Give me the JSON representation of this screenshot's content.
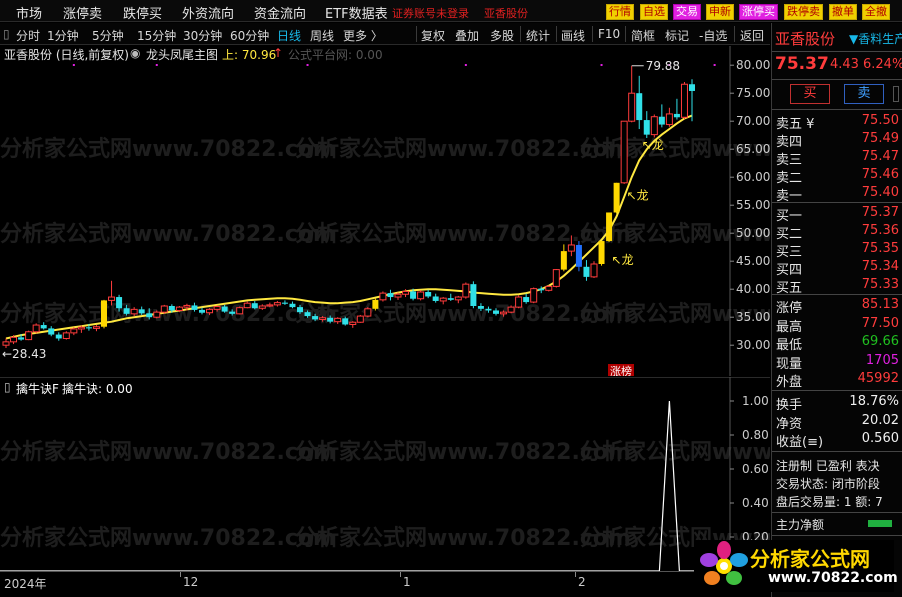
{
  "menu": {
    "items": [
      "市场",
      "涨停卖",
      "跌停买",
      "外资流向",
      "资金流向",
      "ETF数据表"
    ],
    "warning": "证券账号未登录",
    "stock": "亚香股份",
    "buttons": [
      "行情",
      "自选",
      "交易",
      "申新",
      "涨停买",
      "跌停卖",
      "撤单",
      "全撤"
    ]
  },
  "toolbar": {
    "periods": [
      "分时",
      "1分钟",
      "5分钟",
      "15分钟",
      "30分钟",
      "60分钟",
      "日线",
      "周线",
      "更多 〉"
    ],
    "active": "日线",
    "actions": [
      "复权",
      "叠加",
      "多股",
      "统计",
      "画线",
      "F10",
      "简框",
      "标记",
      "-自选",
      "返回"
    ]
  },
  "chart_info": {
    "title": "亚香股份 (日线,前复权)",
    "indicator": "龙头凤尾主图",
    "upper_label": "上: 70.96",
    "watermark_text": "公式平台网: 0.00",
    "high_label": "79.88",
    "low_label": "28.43",
    "dragon_label": "龙",
    "limit_label": "涨榜",
    "watermark": "分析家公式网www.70822.com"
  },
  "sub_chart": {
    "name": "擒牛诀F",
    "value_label": "擒牛诀: 0.00",
    "yticks": [
      "1.00",
      "0.80",
      "0.60",
      "0.40",
      "0.20"
    ]
  },
  "axis": {
    "price_ticks": [
      "80.00",
      "75.00",
      "70.00",
      "65.00",
      "60.00",
      "55.00",
      "50.00",
      "45.00",
      "40.00",
      "35.00",
      "30.00"
    ],
    "x_labels": [
      "2024年",
      "12",
      "1",
      "2"
    ]
  },
  "chart_data": {
    "type": "candlestick",
    "ylim": [
      27,
      82
    ],
    "candles": [
      [
        30.0,
        31.2,
        29.5,
        30.6
      ],
      [
        30.6,
        31.8,
        30.2,
        31.4
      ],
      [
        31.4,
        32.0,
        30.8,
        31.0
      ],
      [
        31.0,
        32.6,
        30.9,
        32.4
      ],
      [
        32.4,
        33.9,
        32.1,
        33.6
      ],
      [
        33.6,
        34.1,
        32.8,
        33.0
      ],
      [
        33.0,
        33.4,
        31.6,
        31.9
      ],
      [
        31.9,
        32.3,
        30.8,
        31.2
      ],
      [
        31.2,
        32.5,
        31.0,
        32.2
      ],
      [
        32.2,
        33.2,
        31.8,
        32.9
      ],
      [
        32.9,
        33.5,
        32.2,
        33.2
      ],
      [
        33.2,
        33.8,
        32.6,
        33.0
      ],
      [
        33.0,
        33.6,
        32.5,
        33.3
      ],
      [
        33.3,
        38.1,
        33.0,
        38.0
      ],
      [
        38.0,
        41.5,
        37.1,
        38.6
      ],
      [
        38.6,
        39.0,
        36.0,
        36.6
      ],
      [
        36.6,
        37.2,
        35.3,
        35.6
      ],
      [
        35.6,
        36.8,
        35.2,
        36.4
      ],
      [
        36.4,
        36.9,
        35.4,
        35.7
      ],
      [
        35.7,
        36.6,
        34.6,
        35.0
      ],
      [
        35.0,
        36.2,
        34.8,
        35.9
      ],
      [
        35.9,
        37.2,
        35.6,
        37.0
      ],
      [
        37.0,
        37.3,
        35.8,
        36.2
      ],
      [
        36.2,
        37.0,
        35.9,
        36.8
      ],
      [
        36.8,
        37.4,
        36.2,
        37.1
      ],
      [
        37.1,
        37.6,
        36.0,
        36.3
      ],
      [
        36.3,
        36.7,
        35.5,
        35.8
      ],
      [
        35.8,
        36.6,
        35.4,
        36.4
      ],
      [
        36.4,
        37.1,
        36.0,
        36.9
      ],
      [
        36.9,
        37.2,
        35.8,
        36.0
      ],
      [
        36.0,
        36.4,
        35.3,
        35.6
      ],
      [
        35.6,
        36.9,
        35.5,
        36.7
      ],
      [
        36.7,
        37.8,
        36.6,
        37.5
      ],
      [
        37.5,
        37.9,
        36.4,
        36.6
      ],
      [
        36.6,
        37.3,
        36.3,
        37.0
      ],
      [
        37.0,
        37.6,
        36.8,
        37.2
      ],
      [
        37.2,
        37.9,
        36.9,
        37.6
      ],
      [
        37.6,
        38.0,
        37.2,
        37.4
      ],
      [
        37.4,
        37.8,
        36.6,
        36.8
      ],
      [
        36.8,
        37.2,
        35.6,
        35.9
      ],
      [
        35.9,
        36.2,
        34.9,
        35.2
      ],
      [
        35.2,
        35.6,
        34.3,
        34.6
      ],
      [
        34.6,
        35.2,
        34.2,
        34.9
      ],
      [
        34.9,
        35.3,
        33.9,
        34.2
      ],
      [
        34.2,
        35.0,
        33.8,
        34.8
      ],
      [
        34.8,
        35.1,
        33.5,
        33.7
      ],
      [
        33.7,
        34.3,
        33.1,
        34.1
      ],
      [
        34.1,
        35.4,
        34.0,
        35.2
      ],
      [
        35.2,
        36.8,
        35.0,
        36.5
      ],
      [
        36.5,
        38.4,
        36.2,
        38.1
      ],
      [
        38.1,
        39.6,
        37.8,
        39.3
      ],
      [
        39.3,
        39.9,
        38.0,
        38.6
      ],
      [
        38.6,
        39.4,
        38.1,
        39.1
      ],
      [
        39.1,
        40.0,
        38.6,
        39.6
      ],
      [
        39.6,
        40.1,
        38.0,
        38.3
      ],
      [
        38.3,
        39.8,
        38.0,
        39.5
      ],
      [
        39.5,
        39.9,
        38.4,
        38.7
      ],
      [
        38.7,
        39.2,
        37.6,
        37.9
      ],
      [
        37.9,
        38.6,
        37.3,
        38.4
      ],
      [
        38.4,
        39.2,
        37.9,
        38.1
      ],
      [
        38.1,
        38.8,
        37.5,
        38.6
      ],
      [
        38.6,
        41.2,
        38.3,
        40.9
      ],
      [
        40.9,
        41.4,
        36.6,
        37.0
      ],
      [
        37.0,
        37.5,
        36.1,
        36.5
      ],
      [
        36.5,
        36.9,
        35.8,
        36.2
      ],
      [
        36.2,
        36.6,
        35.3,
        35.6
      ],
      [
        35.6,
        36.2,
        35.1,
        35.9
      ],
      [
        35.9,
        37.1,
        35.7,
        36.8
      ],
      [
        36.8,
        38.9,
        36.6,
        38.6
      ],
      [
        38.6,
        39.2,
        37.4,
        37.7
      ],
      [
        37.7,
        40.3,
        37.5,
        40.1
      ],
      [
        40.1,
        40.5,
        39.3,
        39.8
      ],
      [
        39.8,
        40.7,
        39.6,
        40.5
      ],
      [
        40.5,
        43.6,
        40.3,
        43.5
      ],
      [
        43.5,
        48.0,
        43.2,
        46.8
      ],
      [
        46.8,
        49.6,
        45.9,
        47.9
      ],
      [
        47.9,
        48.6,
        43.2,
        44.0
      ],
      [
        44.0,
        45.2,
        41.5,
        42.2
      ],
      [
        42.2,
        45.0,
        42.0,
        44.5
      ],
      [
        44.5,
        48.6,
        44.2,
        48.6
      ],
      [
        48.6,
        53.7,
        48.4,
        53.7
      ],
      [
        53.7,
        59.0,
        53.5,
        59.0
      ],
      [
        59.0,
        70.0,
        58.8,
        70.0
      ],
      [
        70.0,
        79.9,
        69.8,
        75.0
      ],
      [
        75.0,
        78.1,
        68.6,
        70.2
      ],
      [
        70.2,
        71.8,
        67.0,
        67.6
      ],
      [
        67.6,
        71.2,
        67.1,
        70.8
      ],
      [
        70.8,
        73.0,
        68.9,
        69.4
      ],
      [
        69.4,
        72.4,
        69.0,
        71.3
      ],
      [
        71.3,
        74.0,
        70.3,
        70.7
      ],
      [
        70.7,
        77.0,
        70.4,
        76.6
      ],
      [
        76.6,
        77.5,
        70.0,
        75.4
      ]
    ],
    "ma_line": [
      31.2,
      31.5,
      31.8,
      32.0,
      32.2,
      32.4,
      32.6,
      32.8,
      33.0,
      33.2,
      33.4,
      33.6,
      33.8,
      34.0,
      34.2,
      34.5,
      34.8,
      35.0,
      35.2,
      35.4,
      35.6,
      35.8,
      36.0,
      36.2,
      36.4,
      36.6,
      36.8,
      37.0,
      37.2,
      37.4,
      37.6,
      37.8,
      38.0,
      38.1,
      38.2,
      38.3,
      38.4,
      38.4,
      38.3,
      38.1,
      37.9,
      37.7,
      37.6,
      37.5,
      37.5,
      37.6,
      37.7,
      37.9,
      38.2,
      38.5,
      38.8,
      39.1,
      39.4,
      39.6,
      39.8,
      39.9,
      40.0,
      40.0,
      39.9,
      39.8,
      39.7,
      39.6,
      39.4,
      39.3,
      39.2,
      39.1,
      39.0,
      39.0,
      39.1,
      39.3,
      39.6,
      40.0,
      40.6,
      41.4,
      42.4,
      43.6,
      44.9,
      46.2,
      47.5,
      48.8,
      50.5,
      53.0,
      56.5,
      60.0,
      63.0,
      65.0,
      66.5,
      67.6,
      68.6,
      69.6,
      70.5,
      71.0
    ],
    "sub_signal": {
      "spike_index": 88,
      "value": 1.0
    }
  },
  "quote": {
    "name": "亚香股份",
    "tag": "▼香料生产",
    "price": "75.37",
    "change": "4.43",
    "pct": "6.24%",
    "buy_btn": "买",
    "sell_btn": "卖",
    "asks": [
      {
        "label": "卖五 ¥",
        "price": "75.50"
      },
      {
        "label": "卖四",
        "price": "75.49"
      },
      {
        "label": "卖三",
        "price": "75.47"
      },
      {
        "label": "卖二",
        "price": "75.46"
      },
      {
        "label": "卖一",
        "price": "75.40"
      }
    ],
    "bids": [
      {
        "label": "买一",
        "price": "75.37"
      },
      {
        "label": "买二",
        "price": "75.36"
      },
      {
        "label": "买三",
        "price": "75.35"
      },
      {
        "label": "买四",
        "price": "75.34"
      },
      {
        "label": "买五",
        "price": "75.33"
      }
    ],
    "stats1": [
      {
        "label": "涨停",
        "value": "85.13",
        "color": "#ff3c3c"
      },
      {
        "label": "最高",
        "value": "77.50",
        "color": "#ff3c3c"
      },
      {
        "label": "最低",
        "value": "69.66",
        "color": "#20c020"
      },
      {
        "label": "现量",
        "value": "1705",
        "color": "#e020e0"
      },
      {
        "label": "外盘",
        "value": "45992",
        "color": "#ff3c3c"
      }
    ],
    "stats2": [
      {
        "label": "换手",
        "value": "18.76%",
        "color": "#f0f0f0"
      },
      {
        "label": "净资",
        "value": "20.02",
        "color": "#f0f0f0"
      },
      {
        "label": "收益(≡)",
        "value": "0.560",
        "color": "#f0f0f0"
      }
    ],
    "status_tags": "注册制 已盈利 表决",
    "trade_status": "交易状态: 闭市阶段",
    "after_hours": "盘后交易量: 1  额: 7",
    "main_flow": "主力净额"
  },
  "logo": {
    "title": "分析家公式网",
    "url": "www.70822.com"
  },
  "colors": {
    "up": "#ff3c3c",
    "down": "#30e0e8",
    "yellow_up": "#ffd800",
    "ma": "#ffe840",
    "bg": "#000000"
  }
}
